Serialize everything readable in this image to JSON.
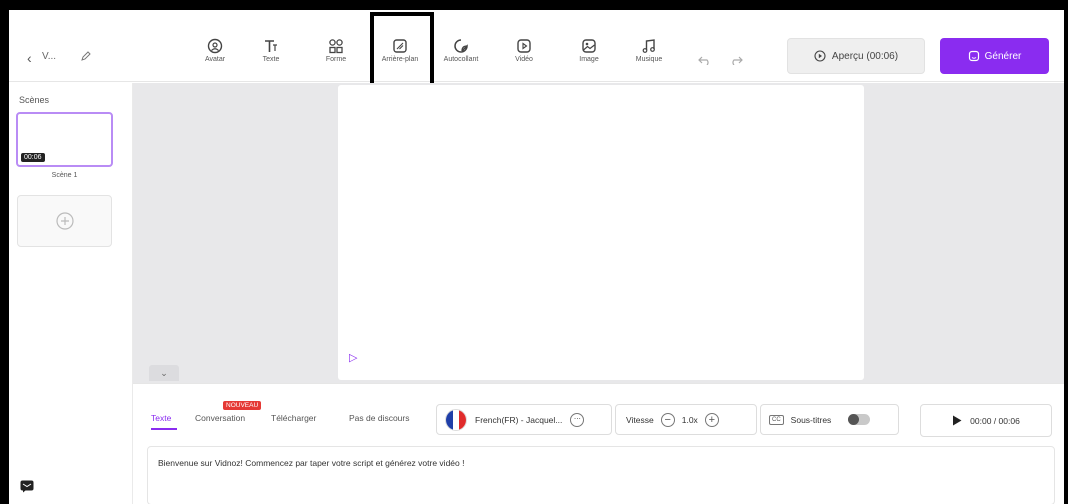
{
  "header": {
    "back_icon": "chevron-left-icon",
    "project_name": "V...",
    "tools": [
      {
        "id": "avatar",
        "label": "Avatar",
        "icon": "avatar-icon"
      },
      {
        "id": "texte",
        "label": "Texte",
        "icon": "text-icon"
      },
      {
        "id": "forme",
        "label": "Forme",
        "icon": "shape-icon"
      },
      {
        "id": "arriere-plan",
        "label": "Arrière-plan",
        "icon": "background-icon"
      },
      {
        "id": "autocollant",
        "label": "Autocollant",
        "icon": "sticker-icon"
      },
      {
        "id": "video",
        "label": "Vidéo",
        "icon": "video-icon"
      },
      {
        "id": "image",
        "label": "Image",
        "icon": "image-icon"
      },
      {
        "id": "musique",
        "label": "Musique",
        "icon": "music-icon"
      }
    ],
    "preview_label": "Aperçu (00:06)",
    "generate_label": "Générer",
    "accent_color": "#8a2cf0"
  },
  "sidebar": {
    "title": "Scènes",
    "scenes": [
      {
        "label": "Scène 1",
        "duration": "00:06"
      }
    ]
  },
  "panel": {
    "tabs": [
      "Texte",
      "Conversation",
      "Télécharger",
      "Pas de discours"
    ],
    "new_badge": "NOUVEAU",
    "voice_label": "French(FR) - Jacquel...",
    "speed_label": "Vitesse",
    "speed_value": "1.0x",
    "subtitles_label": "Sous-titres",
    "time_label": "00:00 / 00:06",
    "script_text": "Bienvenue sur Vidnoz! Commencez par taper votre script et générez votre vidéo !"
  }
}
